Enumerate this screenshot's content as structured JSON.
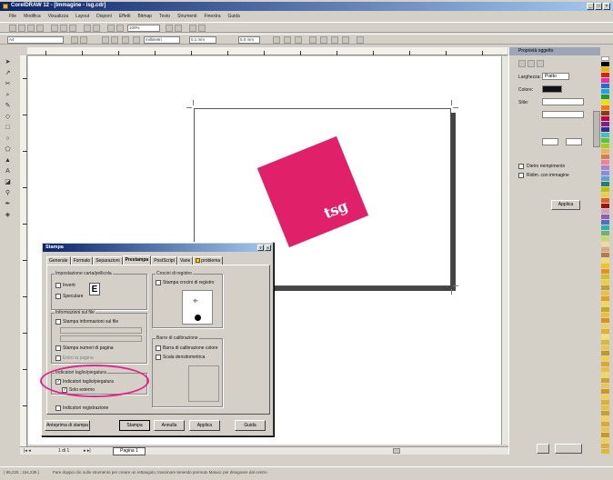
{
  "window": {
    "title": "CorelDRAW 12 - [Immagine - isg.cdr]"
  },
  "menu": [
    "File",
    "Modifica",
    "Visualizza",
    "Layout",
    "Disponi",
    "Effetti",
    "Bitmap",
    "Testo",
    "Strumenti",
    "Finestra",
    "Guida"
  ],
  "toolbar": {
    "zoom": "100%",
    "units": "millimetri",
    "nudge": "0,1 mm",
    "size_a": "5,0 mm"
  },
  "docker": {
    "title": "Proprietà oggetto",
    "outline_width_label": "Larghezza:",
    "outline_width": "Piatto",
    "color_label": "Colore:",
    "style_label": "Stile:",
    "behind_fill": "Dietro riempimento",
    "scale_with_image": "Ridim. con immagine",
    "apply_button": "Applica"
  },
  "dialog": {
    "title": "Stampa",
    "tabs": [
      "Generale",
      "Formato",
      "Separazioni",
      "Prestampa",
      "PostScript",
      "Varie",
      "problema"
    ],
    "active_tab": "Prestampa",
    "groups": {
      "paper_film": "Impostazione carta/pellicola",
      "invert": "Inverti",
      "mirror": "Speculare",
      "file_info": "Informazioni sul file",
      "print_file_info": "Stampa informazioni sul file",
      "print_page_numbers": "Stampa numeri di pagina",
      "within_page": "Entro la pagina",
      "crop_marks_group": "Indicatori taglio/piegatura",
      "crop_fold_marks": "Indicatori taglio/piegatura",
      "exterior_only": "Solo esterno",
      "print_registration": "Indicatori registrazione",
      "registration": "Crocini di registro",
      "print_reg_marks": "Stampa crocini di registro",
      "calibration": "Barre di calibrazione",
      "color_calibration": "Barra di calibrazione colore",
      "densitometer": "Scala densitometrica"
    },
    "buttons": {
      "preview_toggle": "Anteprima di stampa",
      "print": "Stampa",
      "cancel": "Annulla",
      "apply": "Applica",
      "help": "Guida"
    }
  },
  "page_tab": {
    "page_info": "1 di 1",
    "page_label": "Pagina 1"
  },
  "status": {
    "coords": "( 95,225 ; 154,235 )",
    "message": "Fare doppio clic sullo strumento per creare un rettangolo; trascinare tenendo premuto Maiusc per disegnare dal centro"
  },
  "logo": {
    "text": "tsg",
    "color": "#e0216a"
  }
}
